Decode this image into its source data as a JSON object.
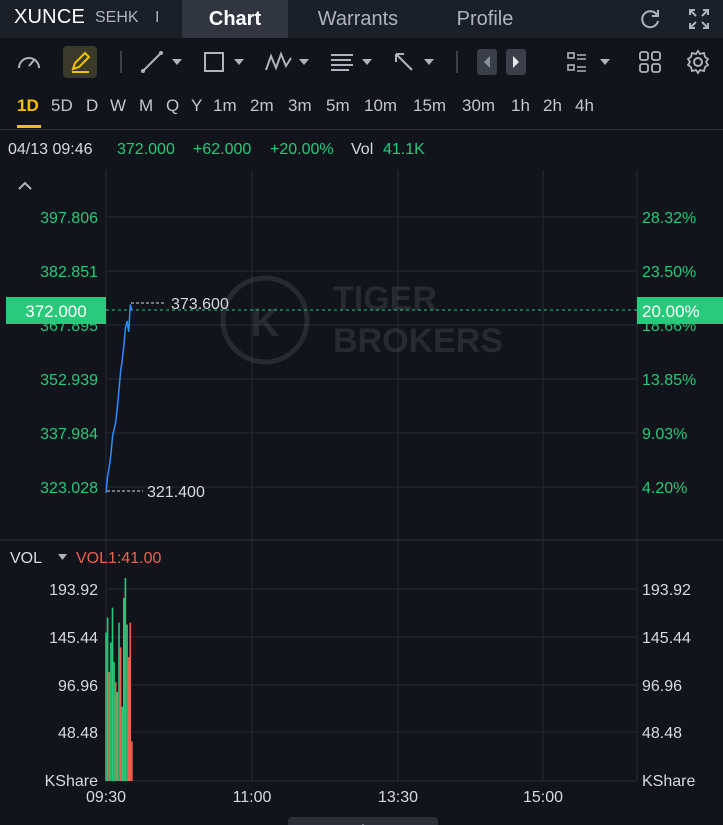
{
  "header": {
    "symbol": "XUNCE",
    "exchange": "SEHK",
    "separator": "I",
    "tabs": [
      {
        "label": "Chart",
        "active": true
      },
      {
        "label": "Warrants",
        "active": false
      },
      {
        "label": "Profile",
        "active": false
      }
    ],
    "icons": [
      "refresh-icon",
      "fullscreen-icon"
    ]
  },
  "toolbar": {
    "icons": [
      "speedometer-icon",
      "draw-pen-icon",
      "line-tool-icon",
      "rectangle-tool-icon",
      "pattern-tool-icon",
      "fibonacci-tool-icon",
      "arrow-tool-icon",
      "scroll-left-icon",
      "scroll-right-icon",
      "indicator-list-icon",
      "grid-layout-icon",
      "settings-icon"
    ]
  },
  "periods": {
    "items": [
      "1D",
      "5D",
      "D",
      "W",
      "M",
      "Q",
      "Y",
      "1m",
      "2m",
      "3m",
      "5m",
      "10m",
      "15m",
      "30m",
      "1h",
      "2h",
      "4h"
    ],
    "active": "1D"
  },
  "quote": {
    "time": "04/13 09:46",
    "price": "372.000",
    "change": "+62.000",
    "change_pct": "+20.00%",
    "vol_label": "Vol",
    "volume": "41.1K"
  },
  "colors": {
    "up": "#28c97a",
    "down": "#f0604f",
    "line": "#2f8cff",
    "background": "#11141b",
    "grid": "#262a33",
    "accent": "#f5c000"
  },
  "chart_data": [
    {
      "type": "line",
      "x_ticks": [
        "09:30",
        "11:00",
        "13:30",
        "15:00"
      ],
      "y_ticks": [
        "397.806",
        "382.851",
        "367.895",
        "352.939",
        "337.984",
        "323.028"
      ],
      "y_pct_ticks": [
        "28.32%",
        "23.50%",
        "18.66%",
        "13.85%",
        "9.03%",
        "4.20%"
      ],
      "ylim": [
        310,
        410
      ],
      "last_price_label": "372.000",
      "last_pct_label": "20.00%",
      "high_label": "373.600",
      "low_label": "321.400",
      "watermark": [
        "TIGER",
        "BROKERS"
      ],
      "series": [
        {
          "x": [
            "09:30",
            "09:31",
            "09:32",
            "09:33",
            "09:34",
            "09:35",
            "09:36",
            "09:37",
            "09:38",
            "09:39",
            "09:40",
            "09:41",
            "09:42",
            "09:43",
            "09:44",
            "09:45",
            "09:46"
          ],
          "values": [
            321.4,
            326.0,
            328.5,
            332.0,
            337.0,
            339.0,
            341.0,
            345.0,
            350.0,
            355.0,
            358.0,
            362.0,
            367.0,
            369.0,
            366.0,
            373.6,
            372.0
          ]
        }
      ]
    },
    {
      "type": "bar",
      "title": "VOL",
      "legend": "VOL1:41.00",
      "x_ticks": [
        "09:30",
        "11:00",
        "13:30",
        "15:00"
      ],
      "y_ticks": [
        "193.92",
        "145.44",
        "96.96",
        "48.48"
      ],
      "y_unit": "KShare",
      "ylim": [
        0,
        200
      ],
      "x": [
        "09:30",
        "09:31",
        "09:32",
        "09:33",
        "09:34",
        "09:35",
        "09:36",
        "09:37",
        "09:38",
        "09:39",
        "09:40",
        "09:41",
        "09:42",
        "09:43",
        "09:44",
        "09:45",
        "09:46"
      ],
      "values": [
        150,
        165,
        110,
        140,
        175,
        120,
        100,
        90,
        160,
        135,
        75,
        185,
        205,
        158,
        125,
        160,
        40
      ],
      "directions": [
        "up",
        "up",
        "down",
        "up",
        "up",
        "up",
        "down",
        "up",
        "up",
        "down",
        "up",
        "up",
        "up",
        "up",
        "down",
        "down",
        "down"
      ]
    }
  ]
}
